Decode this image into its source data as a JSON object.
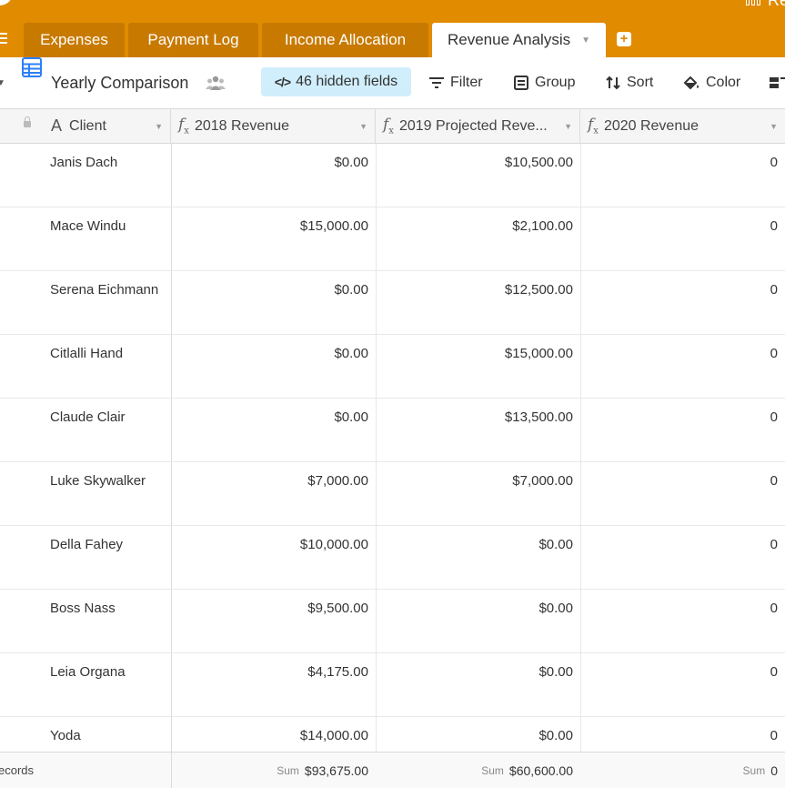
{
  "tabs": [
    {
      "label": "Expenses"
    },
    {
      "label": "Payment Log"
    },
    {
      "label": "Income Allocation"
    },
    {
      "label": "Revenue Analysis",
      "active": true
    }
  ],
  "top_right_text": "Re",
  "view": {
    "name": "Yearly Comparison",
    "hidden_fields": "46 hidden fields",
    "filter": "Filter",
    "group": "Group",
    "sort": "Sort",
    "color": "Color"
  },
  "columns": {
    "client": "Client",
    "rev2018": "2018 Revenue",
    "rev2019": "2019 Projected Reve...",
    "rev2020": "2020 Revenue"
  },
  "rows": [
    {
      "client": "Janis Dach",
      "rev2018": "$0.00",
      "rev2019": "$10,500.00",
      "rev2020": "0"
    },
    {
      "client": "Mace Windu",
      "rev2018": "$15,000.00",
      "rev2019": "$2,100.00",
      "rev2020": "0"
    },
    {
      "client": "Serena Eichmann",
      "rev2018": "$0.00",
      "rev2019": "$12,500.00",
      "rev2020": "0"
    },
    {
      "client": "Citlalli Hand",
      "rev2018": "$0.00",
      "rev2019": "$15,000.00",
      "rev2020": "0"
    },
    {
      "client": "Claude Clair",
      "rev2018": "$0.00",
      "rev2019": "$13,500.00",
      "rev2020": "0"
    },
    {
      "client": "Luke Skywalker",
      "rev2018": "$7,000.00",
      "rev2019": "$7,000.00",
      "rev2020": "0"
    },
    {
      "client": "Della Fahey",
      "rev2018": "$10,000.00",
      "rev2019": "$0.00",
      "rev2020": "0"
    },
    {
      "client": "Boss Nass",
      "rev2018": "$9,500.00",
      "rev2019": "$0.00",
      "rev2020": "0"
    },
    {
      "client": "Leia Organa",
      "rev2018": "$4,175.00",
      "rev2019": "$0.00",
      "rev2020": "0"
    },
    {
      "client": "Yoda",
      "rev2018": "$14,000.00",
      "rev2019": "$0.00",
      "rev2020": "0"
    }
  ],
  "footer": {
    "records_label": "ecords",
    "sum_label": "Sum",
    "sum2018": "$93,675.00",
    "sum2019": "$60,600.00",
    "sum2020": "0"
  },
  "colors": {
    "tabbar": "#e08b00",
    "tab_inactive": "#c87a00",
    "hidden_fields_bg": "#d1eefc",
    "grid_icon": "#2d7ff9"
  }
}
